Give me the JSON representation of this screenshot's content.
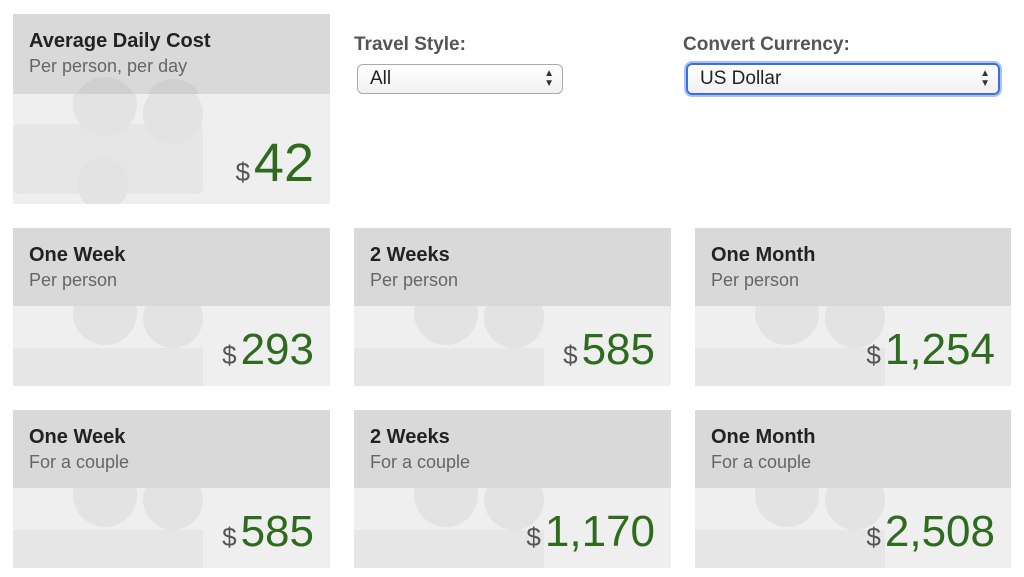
{
  "main_card": {
    "title": "Average Daily Cost",
    "subtitle": "Per person, per day",
    "currency_symbol": "$",
    "amount": "42"
  },
  "controls": {
    "travel_style": {
      "label": "Travel Style:",
      "selected": "All"
    },
    "currency": {
      "label": "Convert Currency:",
      "selected": "US Dollar"
    }
  },
  "cards": [
    {
      "title": "One Week",
      "subtitle": "Per person",
      "currency_symbol": "$",
      "amount": "293"
    },
    {
      "title": "2 Weeks",
      "subtitle": "Per person",
      "currency_symbol": "$",
      "amount": "585"
    },
    {
      "title": "One Month",
      "subtitle": "Per person",
      "currency_symbol": "$",
      "amount": "1,254"
    },
    {
      "title": "One Week",
      "subtitle": "For a couple",
      "currency_symbol": "$",
      "amount": "585"
    },
    {
      "title": "2 Weeks",
      "subtitle": "For a couple",
      "currency_symbol": "$",
      "amount": "1,170"
    },
    {
      "title": "One Month",
      "subtitle": "For a couple",
      "currency_symbol": "$",
      "amount": "2,508"
    }
  ],
  "colors": {
    "amount": "#2e6b1f",
    "card_header": "#d9d9d9",
    "card_body": "#efefef",
    "focus_ring": "#3b6fe0"
  }
}
